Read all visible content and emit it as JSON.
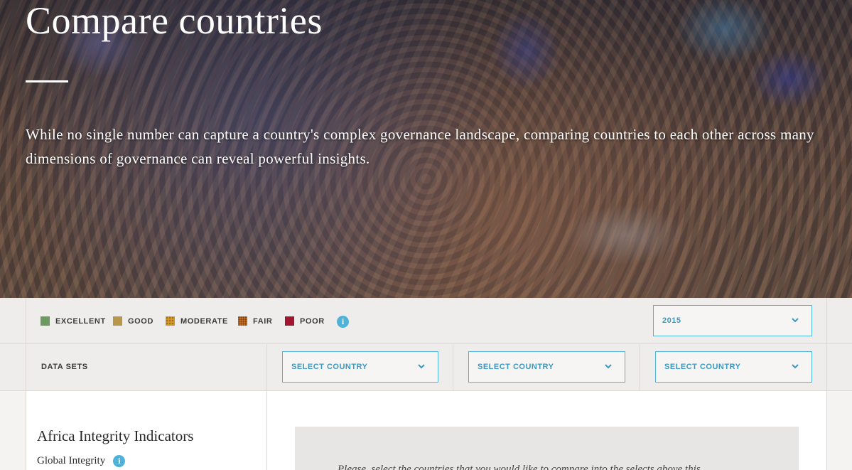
{
  "hero": {
    "title": "Compare countries",
    "description": "While no single number can capture a country's complex governance landscape, comparing countries to each other across many dimensions of governance can reveal powerful insights."
  },
  "legend": {
    "items": [
      {
        "label": "EXCELLENT",
        "color": "#6a9a5d"
      },
      {
        "label": "GOOD",
        "color": "#b8974a"
      },
      {
        "label": "MODERATE",
        "color": "#d69a2c"
      },
      {
        "label": "FAIR",
        "color": "#d07c2c"
      },
      {
        "label": "POOR",
        "color": "#a2152e"
      }
    ],
    "info_icon": "info-icon"
  },
  "year_select": {
    "value": "2015"
  },
  "datasets": {
    "label": "DATA SETS",
    "country_selects": [
      {
        "value": "SELECT COUNTRY"
      },
      {
        "value": "SELECT COUNTRY"
      },
      {
        "value": "SELECT COUNTRY"
      }
    ]
  },
  "sidebar": {
    "title": "Africa Integrity Indicators",
    "subtitle": "Global Integrity"
  },
  "main": {
    "message": "Please, select the countries that you would like to compare into the selects above this"
  },
  "colors": {
    "accent": "#4fb3d9",
    "select_text": "#3b9ac2"
  }
}
